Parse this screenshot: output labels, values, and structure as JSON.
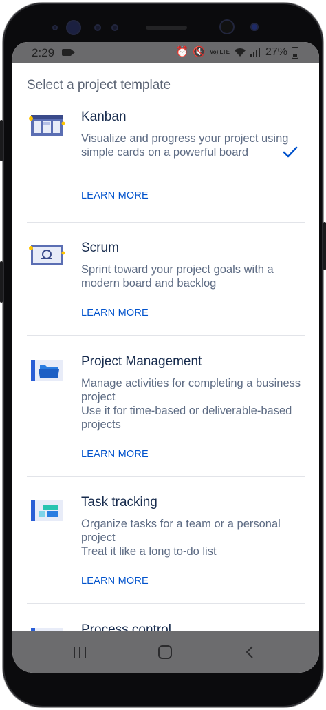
{
  "status_bar": {
    "time": "2:29",
    "battery": "27%",
    "network_label": "Vo) LTE"
  },
  "heading": "Select a project template",
  "templates": [
    {
      "title": "Kanban",
      "description": "Visualize and progress your project using simple cards on a powerful board",
      "learn_more": "LEARN MORE",
      "selected": true,
      "icon": "kanban-thumbnail-icon"
    },
    {
      "title": "Scrum",
      "description": "Sprint toward your project goals with a modern board and backlog",
      "learn_more": "LEARN MORE",
      "selected": false,
      "icon": "scrum-thumbnail-icon"
    },
    {
      "title": "Project Management",
      "description": "Manage activities for completing a business project\nUse it for time-based or deliverable-based projects",
      "learn_more": "LEARN MORE",
      "selected": false,
      "icon": "project-management-thumbnail-icon"
    },
    {
      "title": "Task tracking",
      "description": "Organize tasks for a team or a personal project\nTreat it like a long to-do list",
      "learn_more": "LEARN MORE",
      "selected": false,
      "icon": "task-tracking-thumbnail-icon"
    },
    {
      "title": "Process control",
      "selected": false,
      "icon": "process-control-thumbnail-icon"
    }
  ],
  "nav_bar": {
    "recents_icon": "recents-icon",
    "home_icon": "home-icon",
    "back_icon": "back-icon"
  },
  "colors": {
    "accent": "#0052CC",
    "title": "#172B4D",
    "description": "#5E6C84",
    "heading": "#5B6474"
  }
}
